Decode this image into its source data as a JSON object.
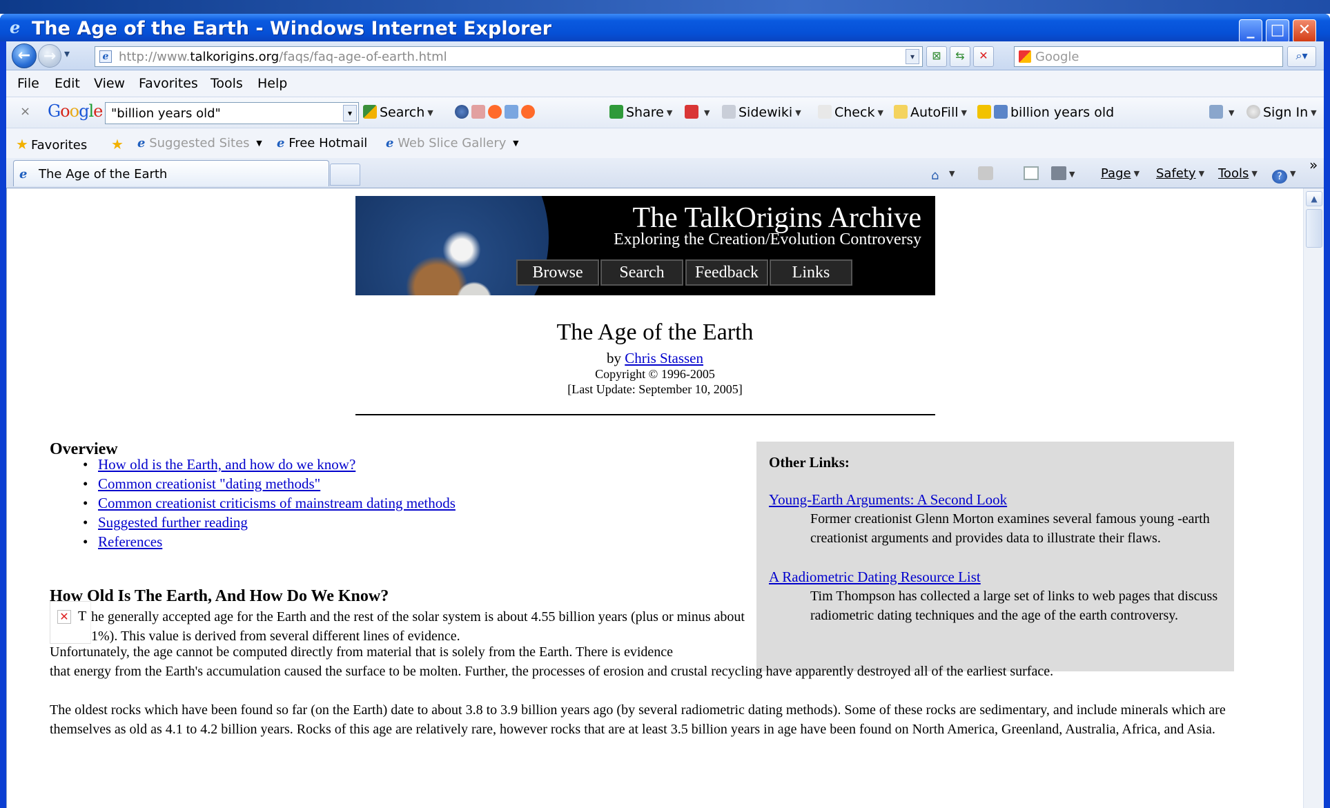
{
  "window": {
    "title": "The Age of the Earth - Windows Internet Explorer",
    "minimize": "_",
    "maximize": "□",
    "close": "✕"
  },
  "address": {
    "url_prefix": "http://www.",
    "url_domain": "talkorigins.org",
    "url_path": "/faqs/faq-age-of-earth.html",
    "search_placeholder": "Google"
  },
  "menu": {
    "items": [
      "File",
      "Edit",
      "View",
      "Favorites",
      "Tools",
      "Help"
    ]
  },
  "google_toolbar": {
    "close": "×",
    "logo": "Google",
    "query": "\"billion years old\"",
    "search_label": "Search",
    "share_label": "Share",
    "sidewiki_label": "Sidewiki",
    "check_label": "Check",
    "autofill_label": "AutoFill",
    "highlight_label": "billion years old",
    "signin_label": "Sign In"
  },
  "favorites_bar": {
    "favorites_label": "Favorites",
    "suggested_sites": "Suggested Sites",
    "free_hotmail": "Free Hotmail",
    "web_slice_gallery": "Web Slice Gallery"
  },
  "tabs": [
    {
      "label": "The Age of the Earth"
    }
  ],
  "command_bar": {
    "page_label": "Page",
    "safety_label": "Safety",
    "tools_label": "Tools",
    "more": "»"
  },
  "banner": {
    "title": "The TalkOrigins Archive",
    "subtitle": "Exploring the Creation/Evolution Controversy",
    "nav": [
      "Browse",
      "Search",
      "Feedback",
      "Links"
    ]
  },
  "article": {
    "title": "The Age of the Earth",
    "by_prefix": "by ",
    "author": "Chris Stassen",
    "copyright": "Copyright © 1996-2005",
    "last_update": "[Last Update: September 10, 2005]",
    "overview_heading": "Overview",
    "toc": [
      "How old is the Earth, and how do we know?",
      "Common creationist \"dating methods\"",
      "Common creationist criticisms of mainstream dating methods",
      "Suggested further reading",
      "References"
    ],
    "section_heading": "How Old Is The Earth, And How Do We Know?",
    "dropcap_alt": "T",
    "para1": "he generally accepted age for the Earth and the rest of the solar system is about 4.55 billion years (plus or minus about 1%). This value is derived from several different lines of evidence.",
    "para2a": "Unfortunately, the age cannot be computed directly from material that is solely from the Earth. There is evidence",
    "para2b": "that energy from the Earth's accumulation caused the surface to be molten. Further, the processes of erosion and crustal recycling have apparently destroyed all of the earliest surface.",
    "para3": "The oldest rocks which have been found so far (on the Earth) date to about 3.8 to 3.9 billion years ago (by several radiometric dating methods). Some of these rocks are sedimentary, and include minerals which are themselves as old as 4.1 to 4.2 billion years. Rocks of this age are relatively rare, however rocks that are at least 3.5 billion years in age have been found on North America, Greenland, Australia, Africa, and Asia."
  },
  "sidebar": {
    "heading": "Other Links:",
    "links": [
      {
        "title": "Young-Earth Arguments: A Second Look",
        "desc": "Former creationist Glenn Morton examines several famous young -earth creationist arguments and provides data to illustrate their flaws."
      },
      {
        "title": "A Radiometric Dating Resource List",
        "desc": "Tim Thompson has collected a large set of links to web pages that discuss radiometric dating techniques and the age of the earth controversy."
      }
    ]
  }
}
